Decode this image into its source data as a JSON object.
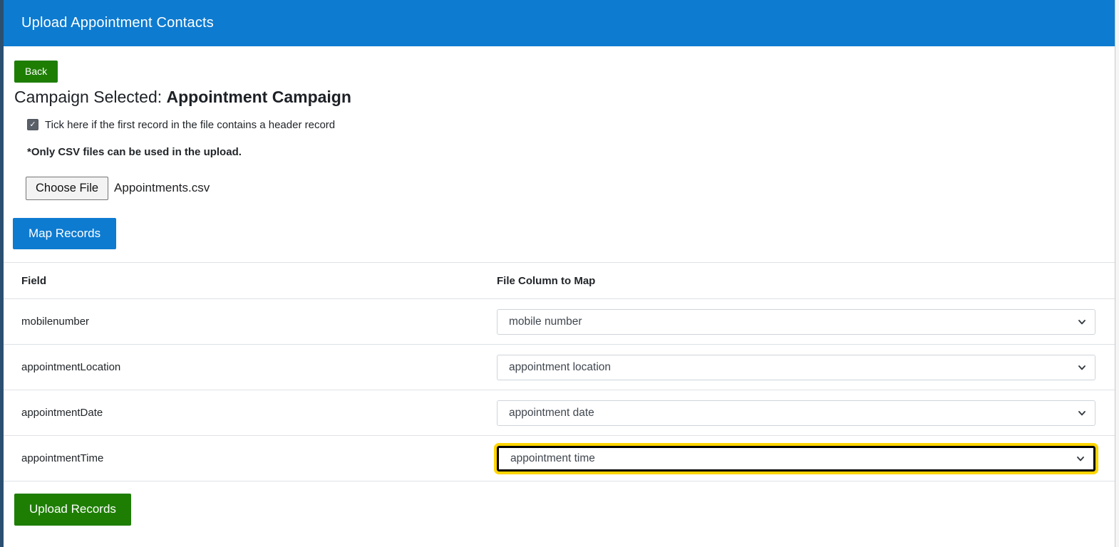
{
  "header": {
    "title": "Upload Appointment Contacts"
  },
  "actions": {
    "back_label": "Back",
    "map_records_label": "Map Records",
    "upload_records_label": "Upload Records"
  },
  "campaign": {
    "prefix": "Campaign Selected: ",
    "name": "Appointment Campaign"
  },
  "header_record_option": {
    "checked": true,
    "label": "Tick here if the first record in the file contains a header record"
  },
  "upload_note": "*Only CSV files can be used in the upload.",
  "file_upload": {
    "button_label": "Choose File",
    "selected_file": "Appointments.csv"
  },
  "mapping_table": {
    "field_column_header": "Field",
    "map_column_header": "File Column to Map",
    "rows": [
      {
        "field": "mobilenumber",
        "selected_option": "mobile number",
        "highlighted": false
      },
      {
        "field": "appointmentLocation",
        "selected_option": "appointment location",
        "highlighted": false
      },
      {
        "field": "appointmentDate",
        "selected_option": "appointment date",
        "highlighted": false
      },
      {
        "field": "appointmentTime",
        "selected_option": "appointment time",
        "highlighted": true
      }
    ]
  },
  "icons": {
    "checkmark": "✓"
  },
  "colors": {
    "header_blue": "#0d7bd0",
    "button_green": "#1e7e04",
    "highlight_yellow": "#ffd500",
    "highlight_border_black": "#000000",
    "left_edge_navy": "#2b4f70"
  }
}
